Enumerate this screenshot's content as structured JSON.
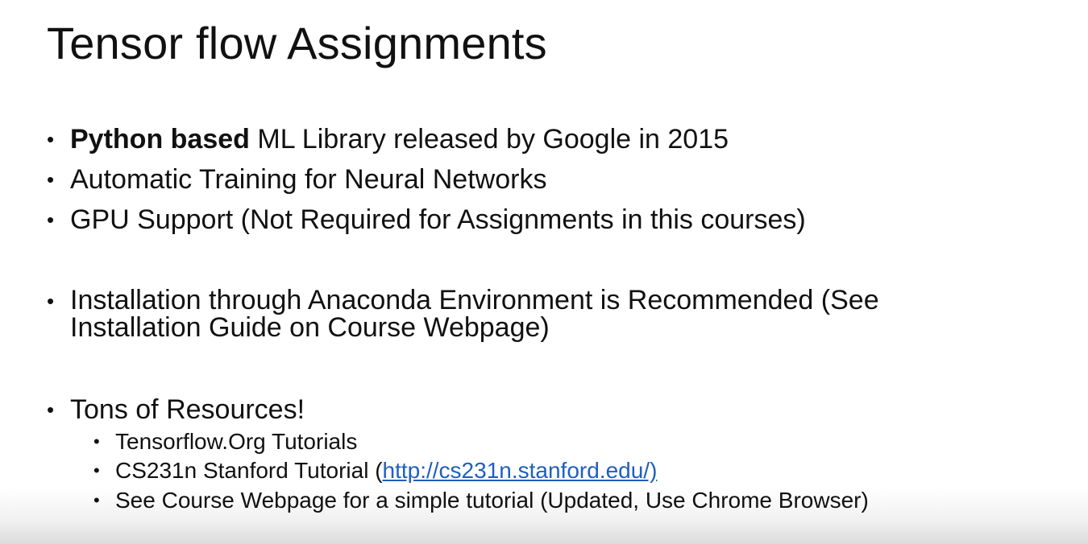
{
  "slide": {
    "title": "Tensor flow Assignments",
    "bullet_glyph": "•",
    "bullets": [
      {
        "bold": "Python based",
        "text": " ML Library released by Google in 2015"
      },
      {
        "text": "Automatic Training for Neural Networks"
      },
      {
        "text": "GPU Support (Not Required for Assignments in this courses)"
      },
      {
        "text": "Installation through Anaconda Environment is Recommended (See Installation Guide on Course Webpage)"
      },
      {
        "text": "Tons of Resources!"
      }
    ],
    "sub_bullets": [
      {
        "text": "Tensorflow.Org Tutorials"
      },
      {
        "text_before": "CS231n Stanford Tutorial (",
        "link": "http://cs231n.stanford.edu/)",
        "text_after": ""
      },
      {
        "text": "See Course Webpage for a simple tutorial (Updated, Use Chrome Browser)"
      }
    ]
  }
}
